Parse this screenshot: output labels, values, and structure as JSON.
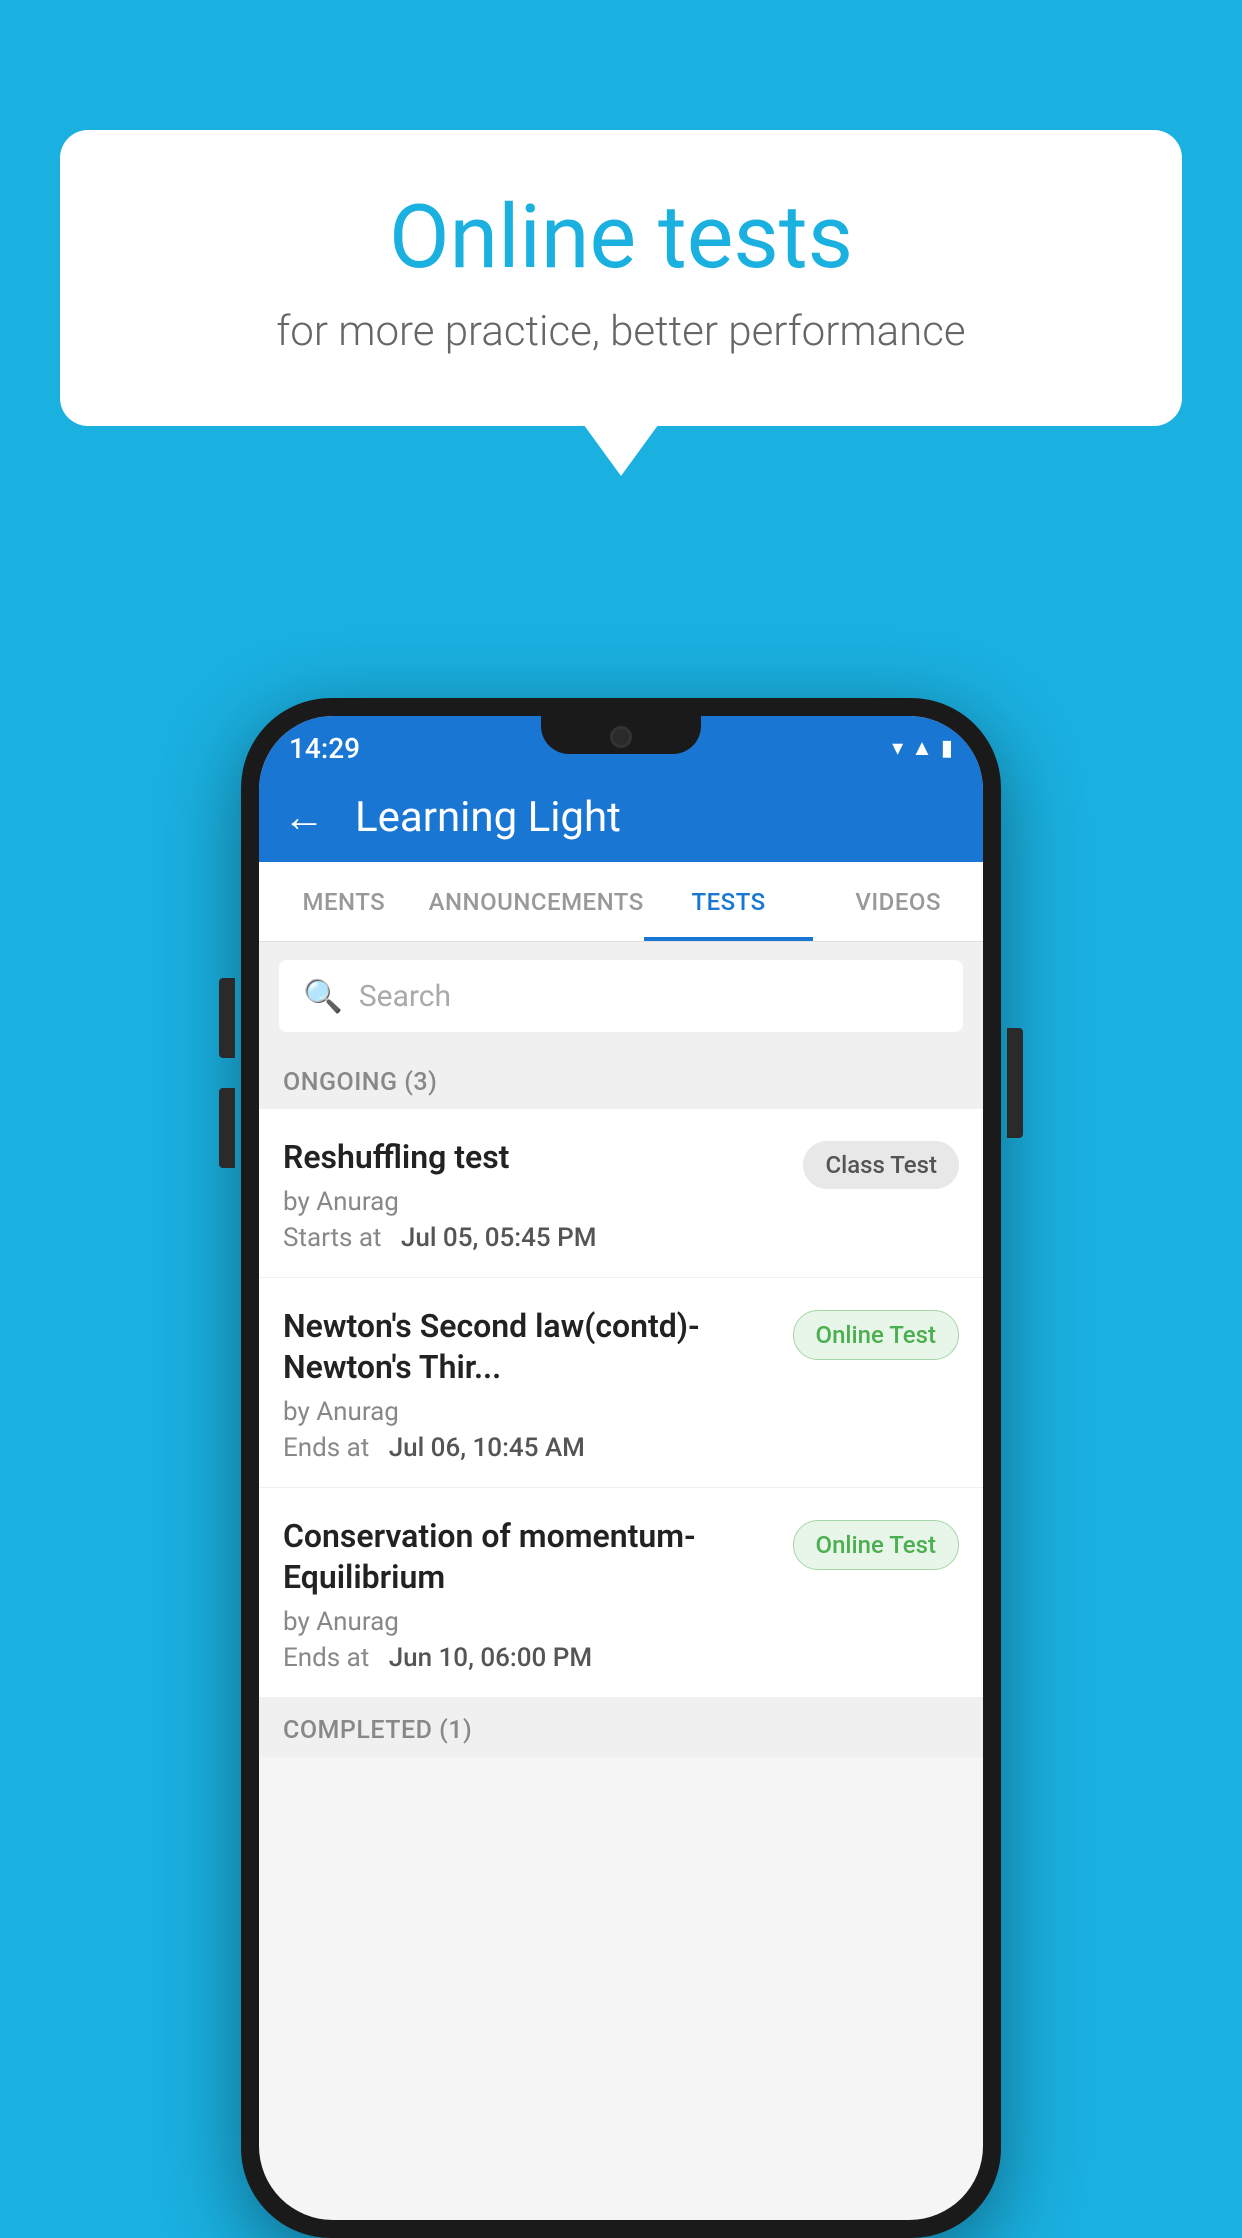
{
  "background_color": "#1ab0e0",
  "bubble": {
    "title": "Online tests",
    "subtitle": "for more practice, better performance"
  },
  "phone": {
    "status_bar": {
      "time": "14:29",
      "icons": [
        "wifi",
        "signal",
        "battery"
      ]
    },
    "header": {
      "title": "Learning Light",
      "back_label": "←"
    },
    "tabs": [
      {
        "label": "MENTS",
        "active": false
      },
      {
        "label": "ANNOUNCEMENTS",
        "active": false
      },
      {
        "label": "TESTS",
        "active": true
      },
      {
        "label": "VIDEOS",
        "active": false
      }
    ],
    "search": {
      "placeholder": "Search"
    },
    "ongoing_section": {
      "label": "ONGOING (3)"
    },
    "tests": [
      {
        "name": "Reshuffling test",
        "author": "by Anurag",
        "time_label": "Starts at",
        "time": "Jul 05, 05:45 PM",
        "badge": "Class Test",
        "badge_type": "class"
      },
      {
        "name": "Newton's Second law(contd)-Newton's Thir...",
        "author": "by Anurag",
        "time_label": "Ends at",
        "time": "Jul 06, 10:45 AM",
        "badge": "Online Test",
        "badge_type": "online"
      },
      {
        "name": "Conservation of momentum-Equilibrium",
        "author": "by Anurag",
        "time_label": "Ends at",
        "time": "Jun 10, 06:00 PM",
        "badge": "Online Test",
        "badge_type": "online"
      }
    ],
    "completed_section": {
      "label": "COMPLETED (1)"
    }
  }
}
